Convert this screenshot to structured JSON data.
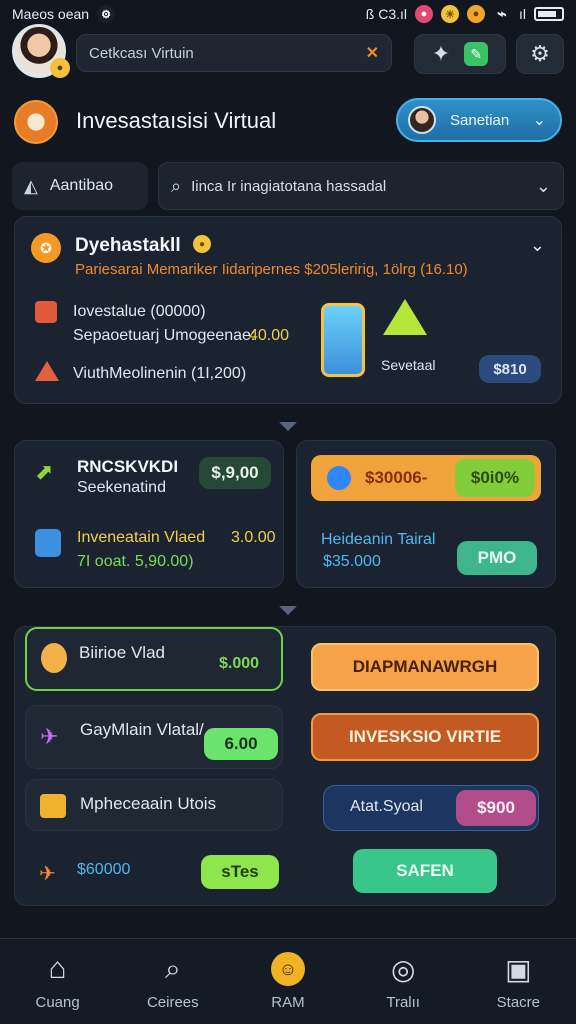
{
  "status_bar": {
    "left_text": "Maeos oean",
    "right_text": "ß C3.ıl",
    "signal_text": "ıl",
    "wifi_icon": "wifi-icon"
  },
  "top_bar": {
    "search_value": "Cetkcası Virtuin",
    "close_label": "✕"
  },
  "app_header": {
    "title": "Invesastaısisi Virtual",
    "account_label": "Sanetian"
  },
  "filter": {
    "tab_label": "Aantibao",
    "search_value": "Iinca Ir inagiatotana hassadal"
  },
  "overview_card": {
    "title": "Dyehastakll",
    "subtitle": "Pariesarai Memariker Iidaripernes $205leririg, 1ölrg (16.10)",
    "row1": "Iovestalue (00000)",
    "row2_label": "Sepaoetuarj Umogeenae:",
    "row2_value": "40.00",
    "row3": "ViuthMeolinenin (1I,200)",
    "side_label": "Sevetaal",
    "side_value": "$810"
  },
  "left_card_1": {
    "title": "RNCSKVKDI",
    "subtitle": "Seekenatind",
    "value": "$,9,00",
    "row_label": "Inveneatain Vlaed",
    "row_value": "3.0.00",
    "row_sub": "7I ooat. 5,90.00)"
  },
  "right_card_1": {
    "orange_value": "$30006-",
    "green_value": "$0i0%",
    "label": "Heideanin Tairal",
    "value": "$35.000",
    "button_label": "PMO"
  },
  "list_items": [
    {
      "label": "Biirioe Vlad",
      "value": "$.000"
    },
    {
      "label": "GayMlain Vlatal/",
      "value": "6.00"
    },
    {
      "label": "Mpheceaain Utois",
      "value": ""
    },
    {
      "label": "$60000",
      "value": "sTes"
    }
  ],
  "actions": {
    "button1": "DIAPMANAWRGH",
    "button2": "INVESKSIO VIRTIE",
    "balance_label": "Atat.Syoal",
    "balance_value": "$900",
    "save_button": "SAFEN"
  },
  "bottom_nav": [
    {
      "label": "Cuang",
      "icon": "home-icon"
    },
    {
      "label": "Ceirees",
      "icon": "search-icon"
    },
    {
      "label": "RAM",
      "icon": "smile-icon"
    },
    {
      "label": "Tralıı",
      "icon": "target-icon"
    },
    {
      "label": "Stacre",
      "icon": "bag-icon"
    }
  ]
}
